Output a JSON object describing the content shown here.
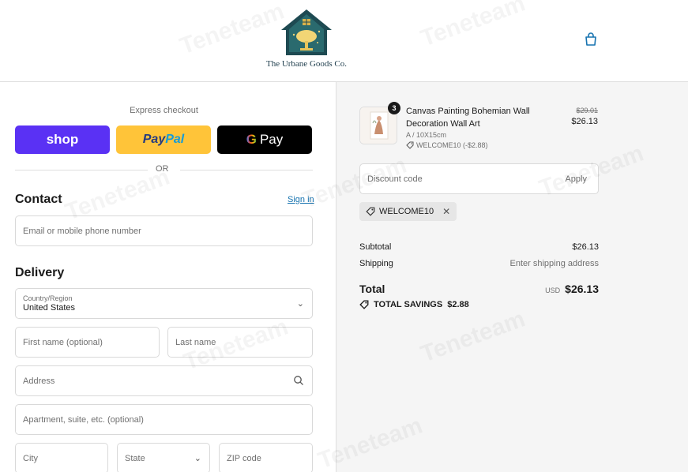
{
  "header": {
    "brand_name": "The Urbane Goods Co."
  },
  "express_checkout": {
    "label": "Express checkout",
    "shop_label": "shop",
    "paypal_part1": "Pay",
    "paypal_part2": "Pal",
    "gpay_g": "G",
    "gpay_label": "Pay",
    "or_label": "OR"
  },
  "contact": {
    "title": "Contact",
    "sign_in": "Sign in",
    "email_placeholder": "Email or mobile phone number"
  },
  "delivery": {
    "title": "Delivery",
    "country_label": "Country/Region",
    "country_value": "United States",
    "first_name_placeholder": "First name (optional)",
    "last_name_placeholder": "Last name",
    "address_placeholder": "Address",
    "apartment_placeholder": "Apartment, suite, etc. (optional)",
    "city_placeholder": "City",
    "state_placeholder": "State",
    "zip_placeholder": "ZIP code"
  },
  "order": {
    "item": {
      "quantity": "3",
      "name": "Canvas Painting Bohemian Wall Decoration Wall Art",
      "variant": "A / 10X15cm",
      "discount": "WELCOME10 (-$2.88)",
      "old_price": "$29.01",
      "price": "$26.13"
    },
    "discount_placeholder": "Discount code",
    "apply_label": "Apply",
    "applied_code": "WELCOME10",
    "subtotal_label": "Subtotal",
    "subtotal_value": "$26.13",
    "shipping_label": "Shipping",
    "shipping_value": "Enter shipping address",
    "total_label": "Total",
    "currency": "USD",
    "total_value": "$26.13",
    "savings_label": "TOTAL SAVINGS",
    "savings_value": "$2.88"
  },
  "watermark": "Teneteam",
  "colors": {
    "shop_purple": "#5a31f4",
    "paypal_yellow": "#ffc439",
    "link_blue": "#1773b0",
    "summary_bg": "#f5f5f5"
  }
}
